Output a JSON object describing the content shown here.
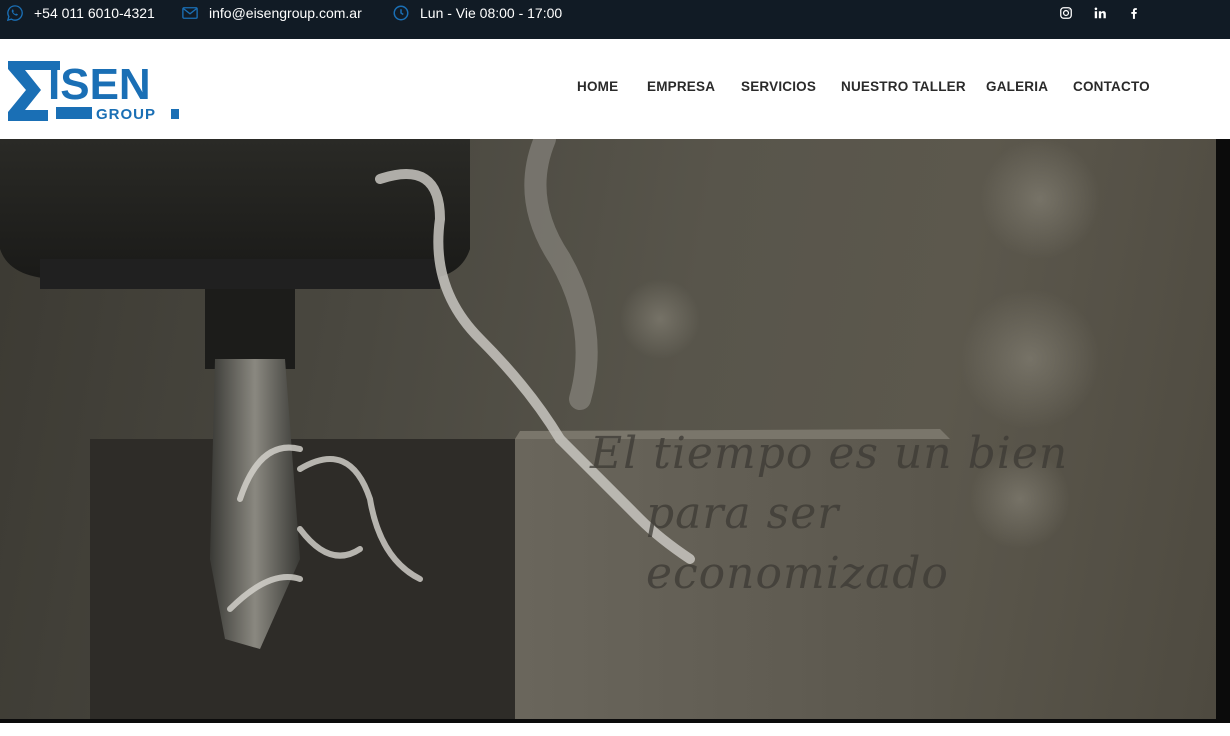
{
  "topbar": {
    "phone": "+54 011 6010-4321",
    "email": "info@eisengroup.com.ar",
    "hours": "Lun - Vie 08:00 - 17:00"
  },
  "logo": {
    "text_main": "ISEN",
    "text_sub": "GROUP",
    "color": "#1a6fb5"
  },
  "nav": {
    "items": [
      {
        "label": "HOME"
      },
      {
        "label": "EMPRESA"
      },
      {
        "label": "SERVICIOS"
      },
      {
        "label": "NUESTRO TALLER"
      },
      {
        "label": "GALERIA"
      },
      {
        "label": "CONTACTO"
      }
    ]
  },
  "hero": {
    "tagline_line1": "El tiempo es un bien",
    "tagline_line2": "para ser economizado"
  },
  "colors": {
    "topbar_bg": "#111b25",
    "icon_blue": "#1a6fb5",
    "nav_text": "#2a2a2a"
  }
}
